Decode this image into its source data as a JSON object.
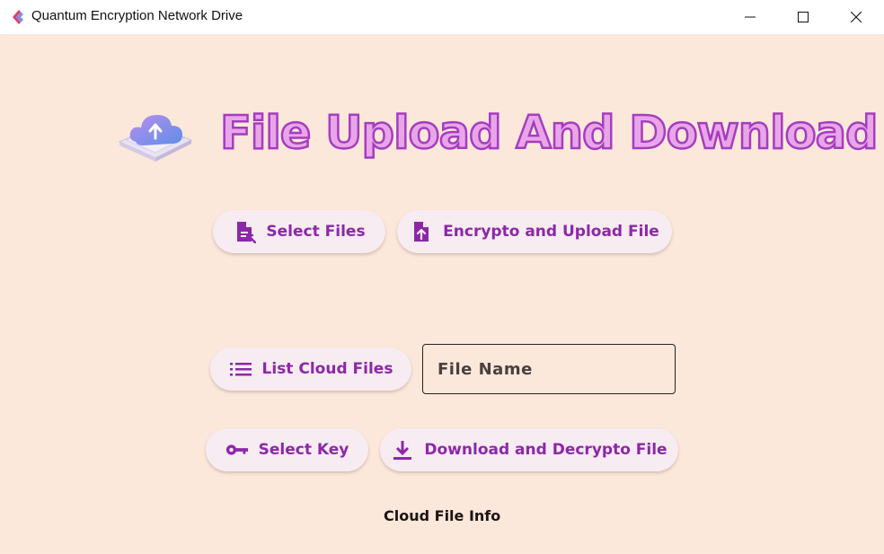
{
  "window": {
    "title": "Quantum Encryption Network Drive",
    "accent_color": "#e23b6a",
    "controls": [
      "minimize-icon",
      "maximize-icon",
      "close-icon"
    ]
  },
  "main": {
    "heading": "File Upload And Download",
    "heading_fill_color": "#e8a6e8",
    "heading_stroke_color": "#a63cc0",
    "hero_icon": "cloud-upload-icon",
    "background_color": "#fbe8da",
    "button_text_color": "#8d27a8",
    "buttons": {
      "select_files": {
        "label": "Select Files",
        "icon": "file-select-icon"
      },
      "encrypt_upload": {
        "label": "Encrypto and Upload File",
        "icon": "file-upload-icon"
      },
      "list_cloud": {
        "label": "List Cloud Files",
        "icon": "list-icon"
      },
      "select_key": {
        "label": "Select Key",
        "icon": "key-icon"
      },
      "download_decrypt": {
        "label": "Download and Decrypto File",
        "icon": "download-icon"
      }
    },
    "file_name_field": {
      "placeholder": "File Name",
      "value": ""
    },
    "cloud_file_info": "Cloud File Info"
  }
}
